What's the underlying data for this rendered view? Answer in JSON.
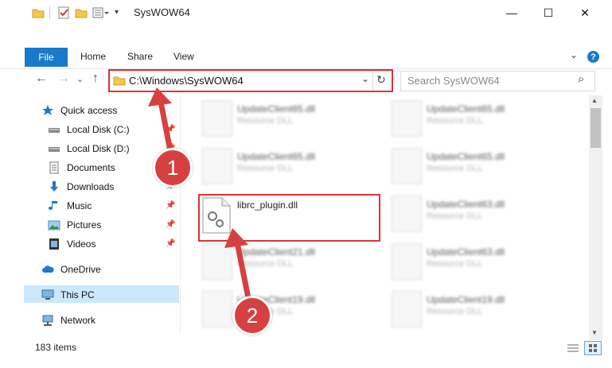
{
  "window": {
    "title": "SysWOW64",
    "minimize_glyph": "—",
    "maximize_glyph": "☐",
    "close_glyph": "✕"
  },
  "ribbon": {
    "file_tab": "File",
    "tabs": [
      "Home",
      "Share",
      "View"
    ],
    "help_glyph": "?",
    "expand_glyph": "⌄"
  },
  "nav": {
    "back_glyph": "←",
    "forward_glyph": "→",
    "recent_glyph": "⌄",
    "up_glyph": "↑",
    "address": "C:\\Windows\\SysWOW64",
    "address_dropdown_glyph": "⌄",
    "refresh_glyph": "↻",
    "search_placeholder": "Search SysWOW64",
    "search_glyph": "⌕"
  },
  "sidebar": {
    "items": [
      {
        "label": "Quick access",
        "icon": "star-icon",
        "pinned": false
      },
      {
        "label": "Local Disk (C:)",
        "icon": "drive-icon",
        "pinned": true
      },
      {
        "label": "Local Disk (D:)",
        "icon": "drive-icon",
        "pinned": true
      },
      {
        "label": "Documents",
        "icon": "document-icon",
        "pinned": true
      },
      {
        "label": "Downloads",
        "icon": "download-icon",
        "pinned": true
      },
      {
        "label": "Music",
        "icon": "music-icon",
        "pinned": true
      },
      {
        "label": "Pictures",
        "icon": "pictures-icon",
        "pinned": true
      },
      {
        "label": "Videos",
        "icon": "video-icon",
        "pinned": true
      },
      {
        "label": "OneDrive",
        "icon": "cloud-icon",
        "pinned": false
      },
      {
        "label": "This PC",
        "icon": "computer-icon",
        "pinned": false,
        "selected": true
      },
      {
        "label": "Network",
        "icon": "network-icon",
        "pinned": false
      }
    ]
  },
  "files": {
    "highlighted": {
      "name": "librc_plugin.dll"
    },
    "left_column": [
      {
        "name": "UpdateClient65.dll",
        "type": "Resource DLL"
      },
      {
        "name": "UpdateClient65.dll",
        "type": "Resource DLL"
      },
      {
        "name": "UpdateClient21.dll",
        "type": "Resource DLL"
      },
      {
        "name": "UpdateClient19.dll",
        "type": "Resource DLL"
      }
    ],
    "right_column": [
      {
        "name": "UpdateClient65.dll",
        "type": "Resource DLL"
      },
      {
        "name": "UpdateClient65.dll",
        "type": "Resource DLL"
      },
      {
        "name": "UpdateClient63.dll",
        "type": "Resource DLL"
      },
      {
        "name": "UpdateClient63.dll",
        "type": "Resource DLL"
      },
      {
        "name": "UpdateClient19.dll",
        "type": "Resource DLL"
      }
    ]
  },
  "status": {
    "item_count": "183 items"
  },
  "annotations": {
    "step1": "1",
    "step2": "2",
    "color": "#d33333"
  },
  "colors": {
    "accent": "#1979ca",
    "selection": "#cce8ff",
    "folder": "#f3c84a"
  }
}
